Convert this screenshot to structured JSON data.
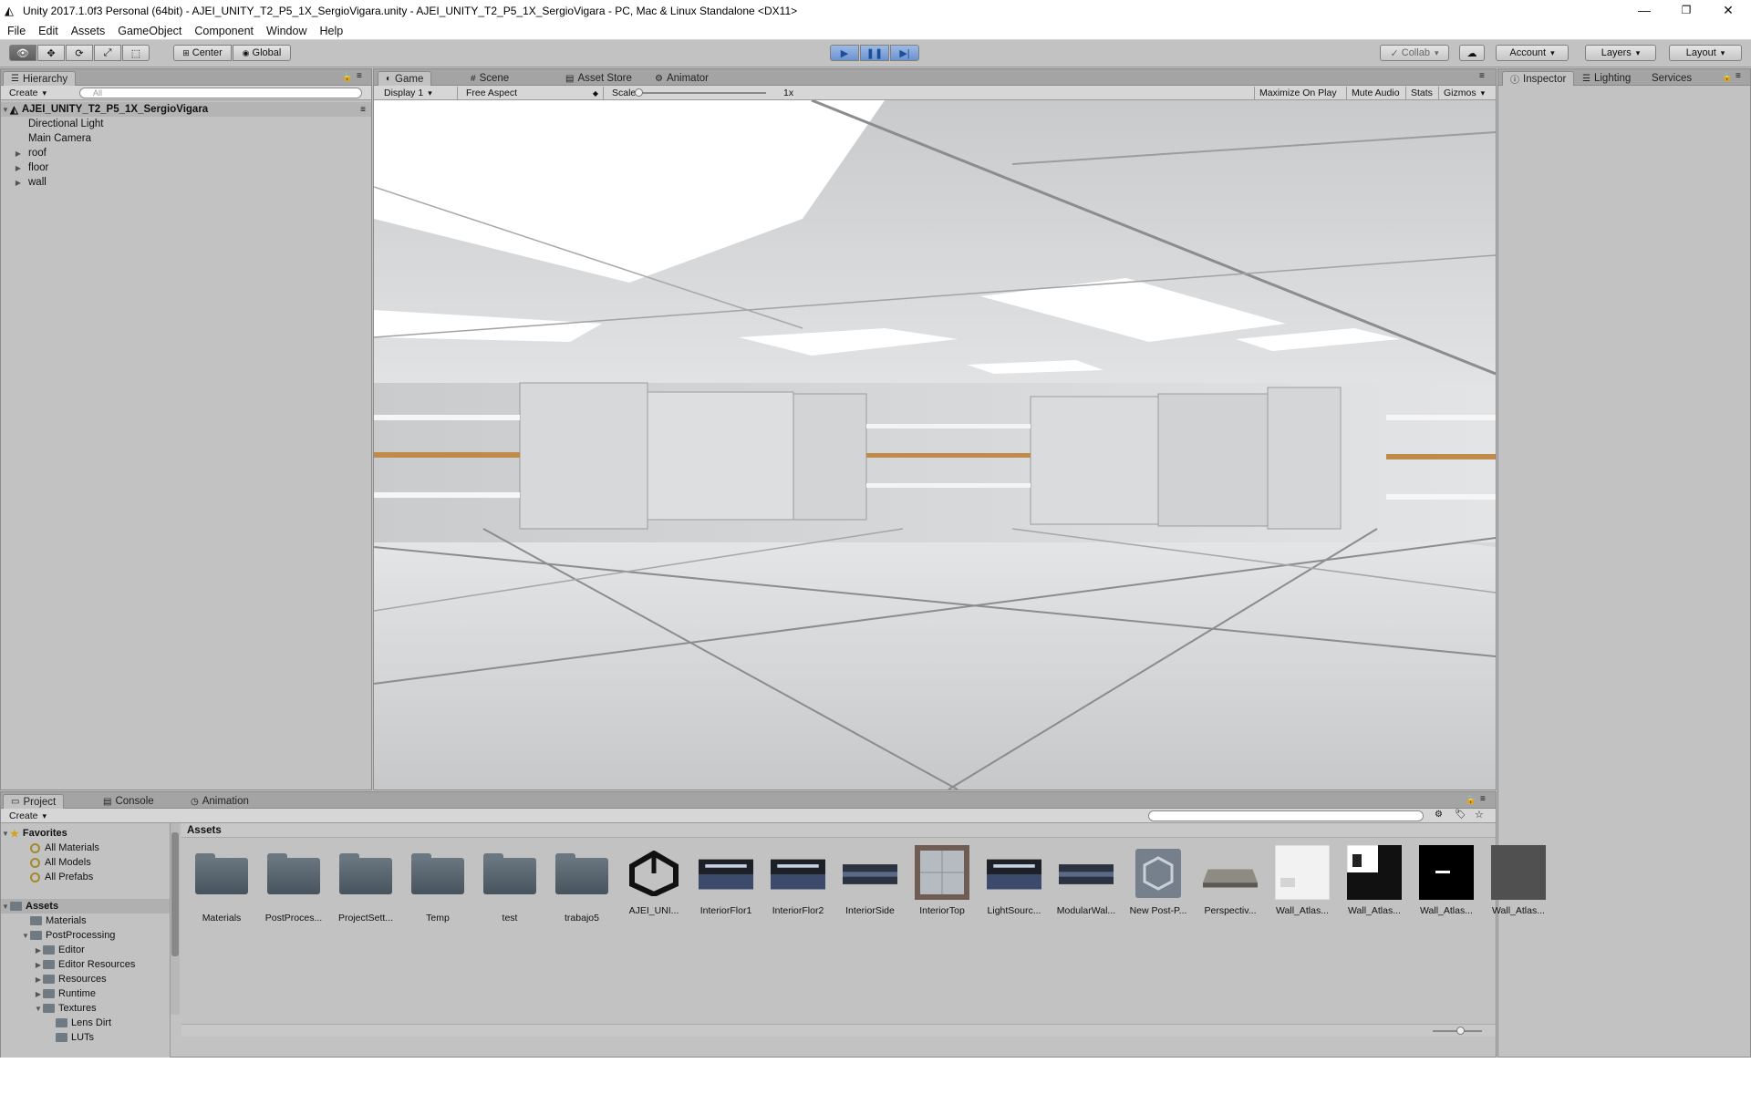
{
  "window": {
    "title": "Unity 2017.1.0f3 Personal (64bit) - AJEI_UNITY_T2_P5_1X_SergioVigara.unity - AJEI_UNITY_T2_P5_1X_SergioVigara - PC, Mac & Linux Standalone <DX11>",
    "minimize": "—",
    "maximize": "❐",
    "close": "✕"
  },
  "menu": [
    "File",
    "Edit",
    "Assets",
    "GameObject",
    "Component",
    "Window",
    "Help"
  ],
  "toolbar": {
    "center": "Center",
    "global": "Global",
    "collab": "Collab",
    "account": "Account",
    "layers": "Layers",
    "layout": "Layout"
  },
  "hierarchy": {
    "tab": "Hierarchy",
    "create": "Create",
    "search_placeholder": "All",
    "scene": "AJEI_UNITY_T2_P5_1X_SergioVigara",
    "items": [
      {
        "label": "Directional Light",
        "expandable": false
      },
      {
        "label": "Main Camera",
        "expandable": false
      },
      {
        "label": "roof",
        "expandable": true
      },
      {
        "label": "floor",
        "expandable": true
      },
      {
        "label": "wall",
        "expandable": true
      }
    ]
  },
  "center_tabs": {
    "game": "Game",
    "scene": "Scene",
    "asset_store": "Asset Store",
    "animator": "Animator"
  },
  "game_bar": {
    "display": "Display 1",
    "aspect": "Free Aspect",
    "scale_label": "Scale",
    "scale_value": "1x",
    "maximize": "Maximize On Play",
    "mute": "Mute Audio",
    "stats": "Stats",
    "gizmos": "Gizmos"
  },
  "inspector_tabs": {
    "inspector": "Inspector",
    "lighting": "Lighting",
    "services": "Services"
  },
  "bottom_tabs": {
    "project": "Project",
    "console": "Console",
    "animation": "Animation"
  },
  "project": {
    "create": "Create",
    "breadcrumb": "Assets",
    "favorites": {
      "label": "Favorites",
      "items": [
        "All Materials",
        "All Models",
        "All Prefabs"
      ]
    },
    "tree": {
      "root": "Assets",
      "items": [
        {
          "label": "Materials",
          "depth": 1,
          "arrow": ""
        },
        {
          "label": "PostProcessing",
          "depth": 1,
          "arrow": "▼"
        },
        {
          "label": "Editor",
          "depth": 2,
          "arrow": "▶"
        },
        {
          "label": "Editor Resources",
          "depth": 2,
          "arrow": "▶"
        },
        {
          "label": "Resources",
          "depth": 2,
          "arrow": "▶"
        },
        {
          "label": "Runtime",
          "depth": 2,
          "arrow": "▶"
        },
        {
          "label": "Textures",
          "depth": 2,
          "arrow": "▼"
        },
        {
          "label": "Lens Dirt",
          "depth": 3,
          "arrow": ""
        },
        {
          "label": "LUTs",
          "depth": 3,
          "arrow": ""
        }
      ]
    },
    "assets": [
      {
        "label": "Materials",
        "kind": "folder"
      },
      {
        "label": "PostProces...",
        "kind": "folder"
      },
      {
        "label": "ProjectSett...",
        "kind": "folder"
      },
      {
        "label": "Temp",
        "kind": "folder"
      },
      {
        "label": "test",
        "kind": "folder"
      },
      {
        "label": "trabajo5",
        "kind": "folder"
      },
      {
        "label": "AJEI_UNI...",
        "kind": "unity"
      },
      {
        "label": "InteriorFlor1",
        "kind": "room"
      },
      {
        "label": "InteriorFlor2",
        "kind": "room"
      },
      {
        "label": "InteriorSide",
        "kind": "bar"
      },
      {
        "label": "InteriorTop",
        "kind": "top"
      },
      {
        "label": "LightSourc...",
        "kind": "room"
      },
      {
        "label": "ModularWal...",
        "kind": "bar"
      },
      {
        "label": "New Post-P...",
        "kind": "postp"
      },
      {
        "label": "Perspectiv...",
        "kind": "persp"
      },
      {
        "label": "Wall_Atlas...",
        "kind": "atlasw"
      },
      {
        "label": "Wall_Atlas...",
        "kind": "atlasbw"
      },
      {
        "label": "Wall_Atlas...",
        "kind": "atlasb"
      },
      {
        "label": "Wall_Atlas...",
        "kind": "atlasg"
      }
    ]
  }
}
